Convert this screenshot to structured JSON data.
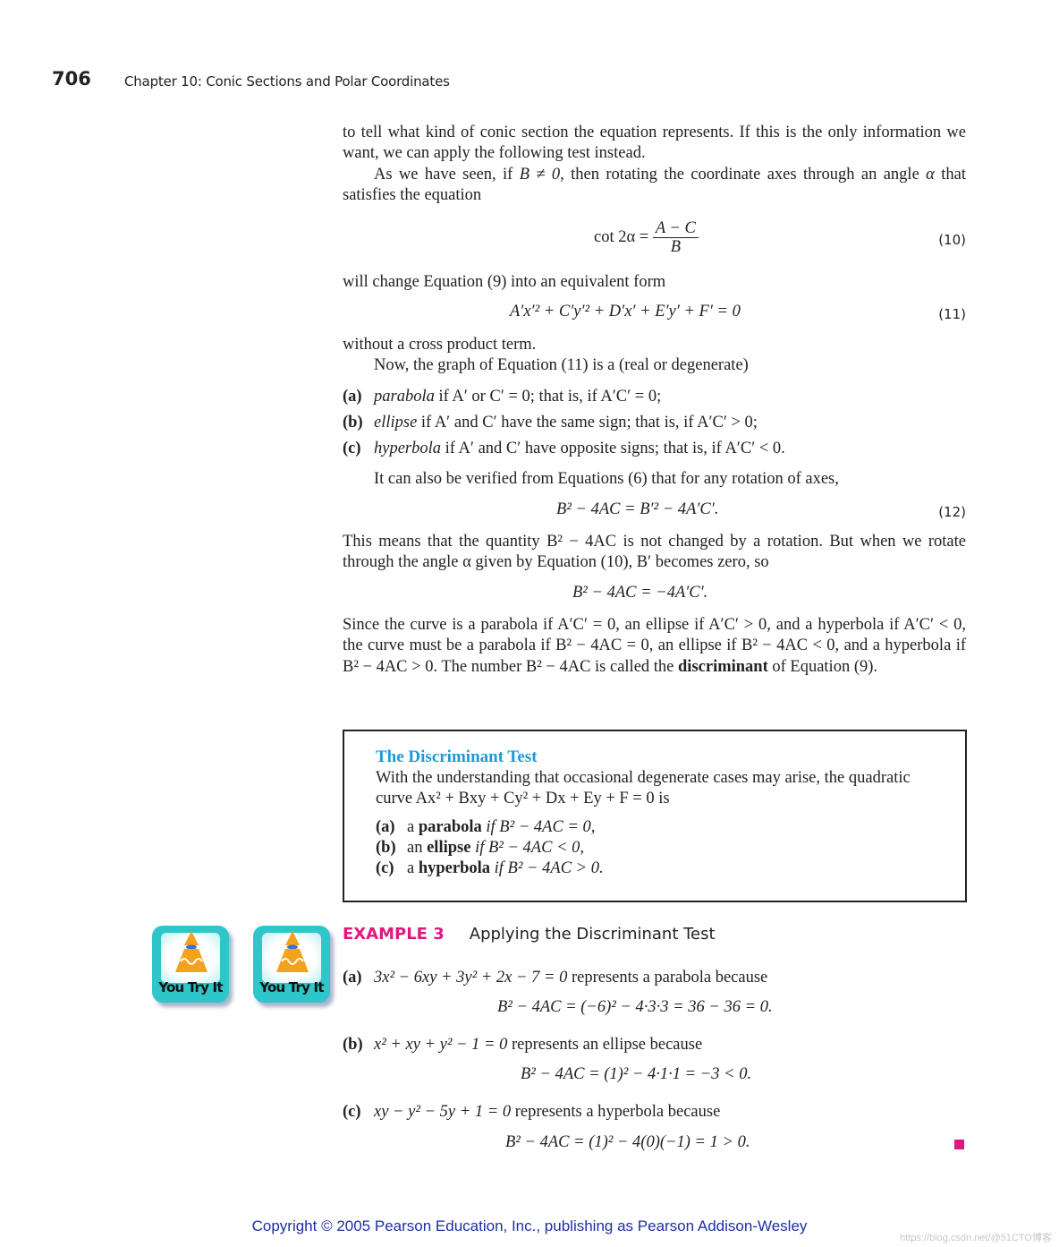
{
  "header": {
    "page_number": "706",
    "running_head": "Chapter 10: Conic Sections and Polar Coordinates"
  },
  "body": {
    "para1": "to tell what kind of conic section the equation represents. If this is the only information we want, we can apply the following test instead.",
    "para2_a": "As we have seen, if ",
    "para2_b": "B ≠ 0",
    "para2_c": ", then rotating the coordinate axes through an angle ",
    "para2_d": "α",
    "para2_e": " that satisfies the equation",
    "eq10": {
      "lhs": "cot 2α = ",
      "numerator": "A − C",
      "denominator": "B",
      "number": "(10)"
    },
    "para3": "will change Equation (9) into an equivalent form",
    "eq11": {
      "text": "A′x′² + C′y′² + D′x′ + E′y′ + F′ = 0",
      "number": "(11)"
    },
    "para4": "without a cross product term.",
    "para5": "Now, the graph of Equation (11) is a (real or degenerate)",
    "cases": [
      {
        "label": "(a)",
        "term": "parabola",
        "text": " if A′ or C′ = 0; that is, if A′C′ = 0;"
      },
      {
        "label": "(b)",
        "term": "ellipse",
        "text": " if A′ and C′ have the same sign; that is, if A′C′ > 0;"
      },
      {
        "label": "(c)",
        "term": "hyperbola",
        "text": " if A′ and C′ have opposite signs; that is, if A′C′ < 0."
      }
    ],
    "para6": "It can also be verified from Equations (6) that for any rotation of axes,",
    "eq12": {
      "text": "B² − 4AC = B′² − 4A′C′.",
      "number": "(12)"
    },
    "para7": "This means that the quantity B² − 4AC is not changed by a rotation. But when we rotate through the angle α given by Equation (10), B′ becomes zero, so",
    "eq13": {
      "text": "B² − 4AC = −4A′C′."
    },
    "para8_a": "Since the curve is a parabola if A′C′ = 0, an ellipse if A′C′ > 0, and a hyperbola if A′C′ < 0, the curve must be a parabola if B² − 4AC = 0, an ellipse if B² − 4AC < 0, and a hyperbola if B² − 4AC > 0. The number B² − 4AC is called the ",
    "para8_bold": "discriminant",
    "para8_c": " of Equation (9)."
  },
  "box": {
    "title": "The Discriminant Test",
    "text": "With the understanding that occasional degenerate cases may arise, the quadratic curve Ax² + Bxy + Cy² + Dx + Ey + F = 0 is",
    "items": [
      {
        "label": "(a)",
        "pre": "a ",
        "term": "parabola",
        "cond": " if B² − 4AC = 0,"
      },
      {
        "label": "(b)",
        "pre": "an ",
        "term": "ellipse",
        "cond": " if B² − 4AC < 0,"
      },
      {
        "label": "(c)",
        "pre": "a ",
        "term": "hyperbola",
        "cond": " if B² − 4AC > 0."
      }
    ],
    "title_color": "#1a9ad6"
  },
  "badges": [
    {
      "label": "You Try It"
    },
    {
      "label": "You Try It"
    }
  ],
  "example": {
    "number": "EXAMPLE 3",
    "title": "Applying the Discriminant Test",
    "accent_color": "#e0177d",
    "parts": [
      {
        "label": "(a)",
        "equation": "3x² − 6xy + 3y² + 2x − 7 = 0",
        "text": " represents a parabola because",
        "calc": "B² − 4AC = (−6)² − 4·3·3 = 36 − 36 = 0."
      },
      {
        "label": "(b)",
        "equation": "x² + xy + y² − 1 = 0",
        "text": " represents an ellipse because",
        "calc": "B² − 4AC = (1)² − 4·1·1 = −3 < 0."
      },
      {
        "label": "(c)",
        "equation": "xy − y² − 5y + 1 = 0",
        "text": " represents a hyperbola because",
        "calc": "B² − 4AC = (1)² − 4(0)(−1) = 1 > 0."
      }
    ]
  },
  "footer": {
    "copyright": "Copyright © 2005 Pearson Education, Inc., publishing as Pearson Addison-Wesley",
    "watermark": "https://blog.csdn.net/@51CTO博客"
  }
}
